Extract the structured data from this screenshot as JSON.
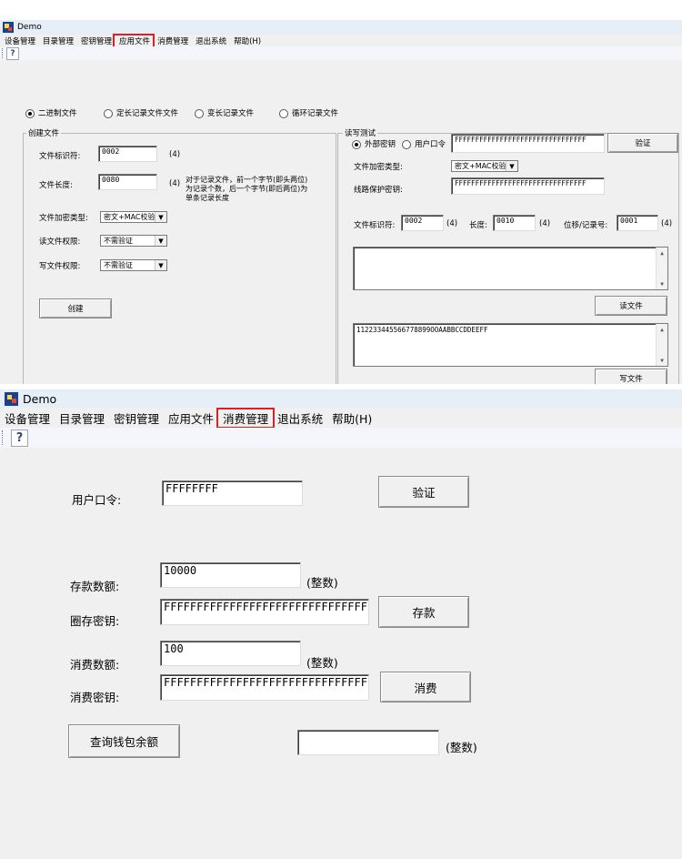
{
  "window1": {
    "title": "Demo",
    "menu": [
      "设备管理",
      "目录管理",
      "密钥管理",
      "应用文件",
      "消费管理",
      "退出系统",
      "帮助(H)"
    ],
    "highlighted_menu": "应用文件",
    "toolbar_help": "?",
    "file_types": [
      "二进制文件",
      "定长记录文件文件",
      "变长记录文件",
      "循环记录文件"
    ],
    "selected_file_type": "二进制文件",
    "create": {
      "group_title": "创建文件",
      "file_id_label": "文件标识符:",
      "file_id_value": "0002",
      "file_id_hint": "(4)",
      "file_length_label": "文件长度:",
      "file_length_value": "0080",
      "file_length_hint": "(4)",
      "file_length_note_1": "对于记录文件，前一个字节(即头两位)",
      "file_length_note_2": "为记录个数，后一个字节(即后两位)为",
      "file_length_note_3": "单条记录长度",
      "encrypt_label": "文件加密类型:",
      "encrypt_value": "密文+MAC校验",
      "read_perm_label": "读文件权限:",
      "read_perm_value": "不需验证",
      "write_perm_label": "写文件权限:",
      "write_perm_value": "不需验证",
      "create_button": "创建"
    },
    "rw": {
      "group_title": "读写测试",
      "auth_options": [
        "外部密钥",
        "用户口令"
      ],
      "selected_auth": "外部密钥",
      "key_value": "FFFFFFFFFFFFFFFFFFFFFFFFFFFFFFFF",
      "verify_button": "验证",
      "encrypt_label": "文件加密类型:",
      "encrypt_value": "密文+MAC校验",
      "line_key_label": "线路保护密钥:",
      "line_key_value": "FFFFFFFFFFFFFFFFFFFFFFFFFFFFFFFF",
      "file_id_label": "文件标识符:",
      "file_id_value": "0002",
      "file_id_hint": "(4)",
      "length_label": "长度:",
      "length_value": "0010",
      "length_hint": "(4)",
      "offset_label": "位移/记录号:",
      "offset_value": "0001",
      "offset_hint": "(4)",
      "read_output": "",
      "read_button": "读文件",
      "write_data": "112233445566778899OOAABBCCDDEEFF",
      "write_button": "写文件"
    }
  },
  "window2": {
    "title": "Demo",
    "menu": [
      "设备管理",
      "目录管理",
      "密钥管理",
      "应用文件",
      "消费管理",
      "退出系统",
      "帮助(H)"
    ],
    "highlighted_menu": "消费管理",
    "toolbar_help": "?",
    "user_pin_label": "用户口令:",
    "user_pin_value": "FFFFFFFF",
    "verify_button": "验证",
    "deposit_amount_label": "存款数额:",
    "deposit_amount_value": "10000",
    "deposit_amount_hint": "(整数)",
    "load_key_label": "圈存密钥:",
    "load_key_value": "FFFFFFFFFFFFFFFFFFFFFFFFFFFFFFFF",
    "deposit_button": "存款",
    "purchase_amount_label": "消费数额:",
    "purchase_amount_value": "100",
    "purchase_amount_hint": "(整数)",
    "purchase_key_label": "消费密钥:",
    "purchase_key_value": "FFFFFFFFFFFFFFFFFFFFFFFFFFFFFFFF",
    "purchase_button": "消费",
    "balance_button": "查询钱包余额",
    "balance_value": "",
    "balance_hint": "(整数)"
  },
  "colors": {
    "window_bg": "#f0f0f0",
    "title_bar_bg": "#e6eef8",
    "highlight_outline": "#e02020",
    "app_icon": "#1b3f91"
  }
}
